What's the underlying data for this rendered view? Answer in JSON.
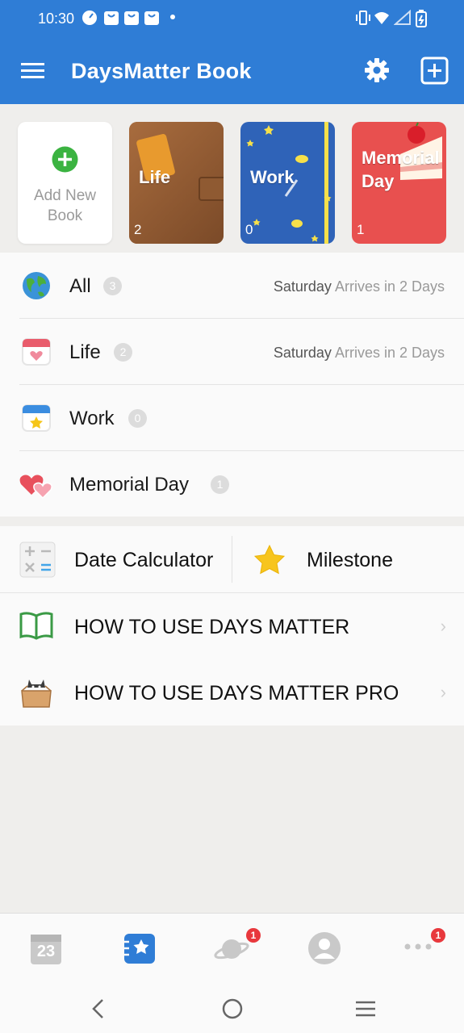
{
  "status_bar": {
    "time": "10:30"
  },
  "app_bar": {
    "title": "DaysMatter Book"
  },
  "books": [
    {
      "label": "Add New Book"
    },
    {
      "label": "Life",
      "count": "2"
    },
    {
      "label": "Work",
      "count": "0"
    },
    {
      "label": "Memorial Day",
      "count": "1"
    }
  ],
  "categories": [
    {
      "name": "All",
      "count": "3",
      "day": "Saturday",
      "arrives": "Arrives in 2  Days"
    },
    {
      "name": "Life",
      "count": "2",
      "day": "Saturday",
      "arrives": "Arrives in 2  Days"
    },
    {
      "name": "Work",
      "count": "0"
    },
    {
      "name": "Memorial Day",
      "count": "1"
    }
  ],
  "tools": {
    "date_calculator": "Date Calculator",
    "milestone": "Milestone",
    "how_to_use": "HOW TO USE DAYS MATTER",
    "how_to_use_pro": "HOW TO USE DAYS MATTER PRO"
  },
  "bottom_nav": {
    "calendar_date": "23",
    "planet_badge": "1",
    "more_badge": "1"
  },
  "colors": {
    "app_bar": "#2f7dd6",
    "accent_green": "#3bb341",
    "work_book": "#2f63b8",
    "memorial_book": "#e8504f",
    "badge_red": "#e8383d"
  }
}
